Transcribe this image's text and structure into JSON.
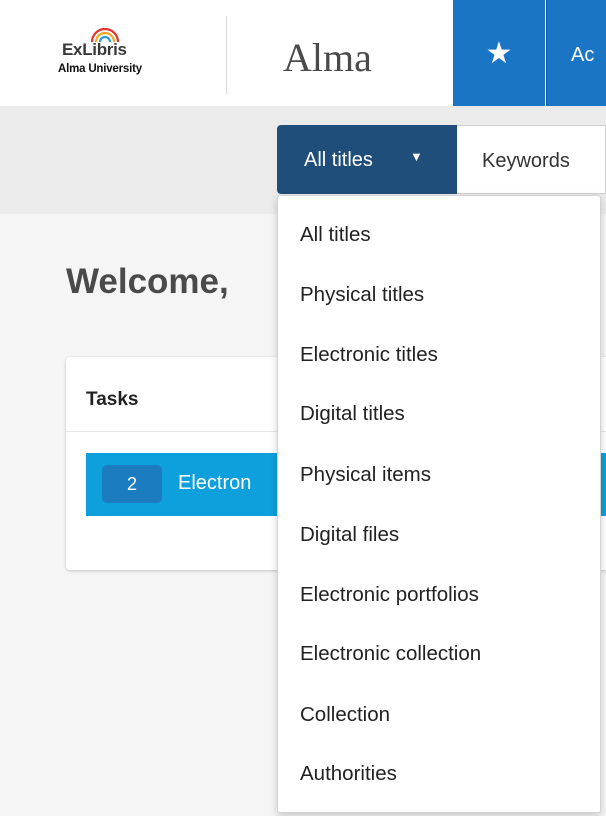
{
  "header": {
    "logo_main": "ExLibris",
    "logo_sub": "Alma University",
    "app_title": "Alma",
    "favorites_icon": "star-icon",
    "account_label_partial": "Ac"
  },
  "search": {
    "scope_label": "All titles",
    "scope_caret": "▼",
    "field_label": "Keywords"
  },
  "main": {
    "welcome_text": "Welcome,",
    "tasks": {
      "title": "Tasks",
      "items": [
        {
          "count": "2",
          "label": "Electron"
        }
      ]
    }
  },
  "dropdown": {
    "items": [
      "All titles",
      "Physical titles",
      "Electronic titles",
      "Digital titles",
      "Physical items",
      "Digital files",
      "Electronic portfolios",
      "Electronic collection",
      "Collection",
      "Authorities"
    ]
  },
  "colors": {
    "header_blue": "#1a75c4",
    "scope_navy": "#1f4e7a",
    "task_cyan": "#0ea0dc",
    "badge_blue": "#1b7cc0"
  }
}
